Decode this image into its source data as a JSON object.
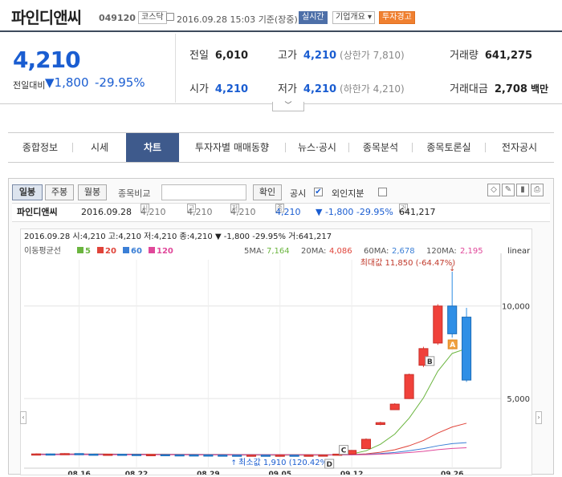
{
  "header": {
    "name": "파인디앤씨",
    "code": "049120",
    "market": "코스닥",
    "datetime": "2016.09.28 15:03",
    "basis": "기준(장중)",
    "realtime": "실시간",
    "overview": "기업개요",
    "warning": "투자경고"
  },
  "quote": {
    "price": "4,210",
    "prev_label": "전일대비",
    "change": "1,800",
    "pct": "-29.95%"
  },
  "stats": [
    {
      "k": "전일",
      "v": "6,010",
      "sub": ""
    },
    {
      "k": "고가",
      "v": "4,210",
      "sub": "(상한가 7,810)"
    },
    {
      "k": "거래량",
      "v": "641,275",
      "sub": ""
    },
    {
      "k": "시가",
      "v": "4,210",
      "sub": ""
    },
    {
      "k": "저가",
      "v": "4,210",
      "sub": "(하한가 4,210)"
    },
    {
      "k": "거래대금",
      "v": "2,708",
      "sub": "백만"
    }
  ],
  "tabs": [
    "종합정보",
    "시세",
    "차트",
    "투자자별 매매동향",
    "뉴스·공시",
    "종목분석",
    "종목토론실",
    "전자공시"
  ],
  "toolbar": {
    "daily": "일봉",
    "weekly": "주봉",
    "monthly": "월봉",
    "compare": "종목비교",
    "confirm": "확인",
    "notice": "공시",
    "foreign": "외인지분"
  },
  "quotebar": {
    "name": "파인디앤씨",
    "date": "2016.09.28",
    "open": "4,210",
    "high": "4,210",
    "low": "4,210",
    "close": "4,210",
    "change": "▼ -1,800 -29.95%",
    "volume": "641,217"
  },
  "chart_data": {
    "type": "candlestick",
    "info_line": "2016.09.28 시:4,210 고:4,210 저:4,210 종:4,210 ▼  -1,800 -29.95% 거:641,217",
    "scale": "linear",
    "ma_legend_label": "이동평균선",
    "ma": [
      {
        "name": "5",
        "color": "#6bb53f"
      },
      {
        "name": "20",
        "color": "#e0443a"
      },
      {
        "name": "60",
        "color": "#3b7fd6"
      },
      {
        "name": "120",
        "color": "#e0489a"
      }
    ],
    "ma_values": {
      "5MA:": "7,164",
      "20MA:": "4,086",
      "60MA:": "2,678",
      "120MA:": "2,195"
    },
    "max_label": "최대값 11,850 (-64.47%)",
    "min_label": "최소값 1,910 (120.42%)",
    "y_ticks": [
      10000,
      5000
    ],
    "y_tick_labels": [
      "10,000",
      "5,000"
    ],
    "x_ticks": [
      "08.16",
      "08.22",
      "08.29",
      "09.05",
      "09.12",
      "09.26"
    ],
    "markers": [
      "A",
      "B",
      "C",
      "D"
    ],
    "candles": [
      {
        "date": "08.10",
        "o": 2000,
        "c": 2010,
        "h": 2040,
        "l": 1980
      },
      {
        "date": "08.11",
        "o": 2010,
        "c": 1990,
        "h": 2030,
        "l": 1970
      },
      {
        "date": "08.12",
        "o": 2000,
        "c": 2030,
        "h": 2050,
        "l": 1990
      },
      {
        "date": "08.16",
        "o": 2030,
        "c": 2005,
        "h": 2040,
        "l": 1990
      },
      {
        "date": "08.17",
        "o": 2000,
        "c": 1980,
        "h": 2020,
        "l": 1960
      },
      {
        "date": "08.18",
        "o": 1990,
        "c": 1995,
        "h": 2010,
        "l": 1970
      },
      {
        "date": "08.19",
        "o": 1995,
        "c": 1985,
        "h": 2000,
        "l": 1970
      },
      {
        "date": "08.22",
        "o": 1985,
        "c": 1970,
        "h": 1995,
        "l": 1960
      },
      {
        "date": "08.23",
        "o": 1970,
        "c": 1975,
        "h": 1985,
        "l": 1960
      },
      {
        "date": "08.24",
        "o": 1975,
        "c": 1965,
        "h": 1980,
        "l": 1955
      },
      {
        "date": "08.25",
        "o": 1965,
        "c": 1960,
        "h": 1975,
        "l": 1950
      },
      {
        "date": "08.26",
        "o": 1960,
        "c": 1955,
        "h": 1970,
        "l": 1945
      },
      {
        "date": "08.29",
        "o": 1955,
        "c": 1950,
        "h": 1965,
        "l": 1930
      },
      {
        "date": "08.30",
        "o": 1950,
        "c": 1945,
        "h": 1960,
        "l": 1920
      },
      {
        "date": "08.31",
        "o": 1945,
        "c": 1940,
        "h": 1955,
        "l": 1910
      },
      {
        "date": "09.01",
        "o": 1940,
        "c": 1945,
        "h": 1955,
        "l": 1920
      },
      {
        "date": "09.02",
        "o": 1945,
        "c": 1940,
        "h": 1955,
        "l": 1930
      },
      {
        "date": "09.05",
        "o": 1940,
        "c": 1945,
        "h": 1955,
        "l": 1930
      },
      {
        "date": "09.06",
        "o": 1945,
        "c": 1940,
        "h": 1955,
        "l": 1930
      },
      {
        "date": "09.07",
        "o": 1940,
        "c": 1945,
        "h": 1955,
        "l": 1930
      },
      {
        "date": "09.08",
        "o": 1945,
        "c": 1950,
        "h": 1960,
        "l": 1935
      },
      {
        "date": "09.09",
        "o": 1950,
        "c": 2000,
        "h": 2010,
        "l": 1945
      },
      {
        "date": "09.12",
        "o": 2000,
        "c": 2200,
        "h": 2220,
        "l": 1990
      },
      {
        "date": "09.13",
        "o": 2300,
        "c": 2800,
        "h": 2850,
        "l": 2280
      },
      {
        "date": "09.19",
        "o": 3600,
        "c": 3700,
        "h": 3750,
        "l": 3560
      },
      {
        "date": "09.20",
        "o": 4400,
        "c": 4700,
        "h": 4750,
        "l": 4380
      },
      {
        "date": "09.21",
        "o": 5000,
        "c": 6300,
        "h": 6350,
        "l": 4980
      },
      {
        "date": "09.22",
        "o": 6800,
        "c": 7700,
        "h": 7800,
        "l": 6700
      },
      {
        "date": "09.23",
        "o": 8000,
        "c": 10000,
        "h": 10100,
        "l": 7900
      },
      {
        "date": "09.26",
        "o": 10000,
        "c": 8500,
        "h": 11850,
        "l": 8300
      },
      {
        "date": "09.27",
        "o": 9400,
        "c": 6000,
        "h": 9900,
        "l": 5900
      }
    ]
  }
}
